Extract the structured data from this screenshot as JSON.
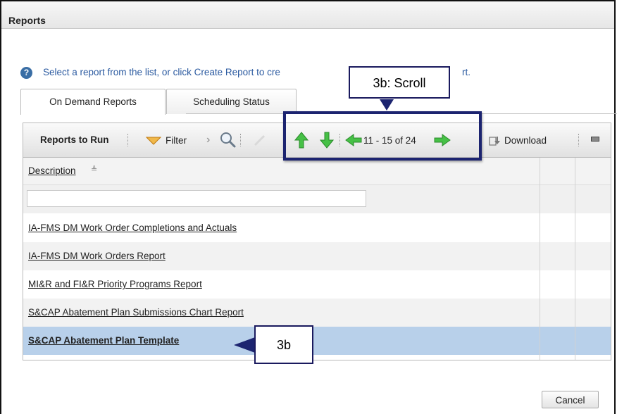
{
  "window": {
    "title": "Reports"
  },
  "info": {
    "icon": "help-icon",
    "text": "Select a report from the list, or click Create Report to cre",
    "tail": "rt."
  },
  "tabs": [
    {
      "label": "On Demand Reports",
      "active": true
    },
    {
      "label": "Scheduling Status",
      "active": false
    }
  ],
  "toolbar": {
    "title": "Reports to Run",
    "filter_label": "Filter",
    "pagination": "11 - 15 of 24",
    "download_label": "Download"
  },
  "grid": {
    "column_header": "Description",
    "filter_value": "",
    "rows": [
      {
        "label": "IA-FMS DM Work Order Completions and Actuals",
        "selected": false
      },
      {
        "label": "IA-FMS DM Work Orders Report",
        "selected": false
      },
      {
        "label": "MI&R and FI&R Priority Programs Report",
        "selected": false
      },
      {
        "label": "S&CAP Abatement Plan Submissions Chart Report",
        "selected": false
      },
      {
        "label": "S&CAP Abatement Plan Template",
        "selected": true
      }
    ]
  },
  "annotations": {
    "scroll_callout": "3b: Scroll",
    "row_callout": "3b"
  },
  "footer": {
    "cancel_label": "Cancel"
  },
  "colors": {
    "selected_row": "#b8d0ea",
    "callout_border": "#1c2470",
    "arrow_green": "#3cb83c",
    "link_blue": "#2b5aa0"
  }
}
